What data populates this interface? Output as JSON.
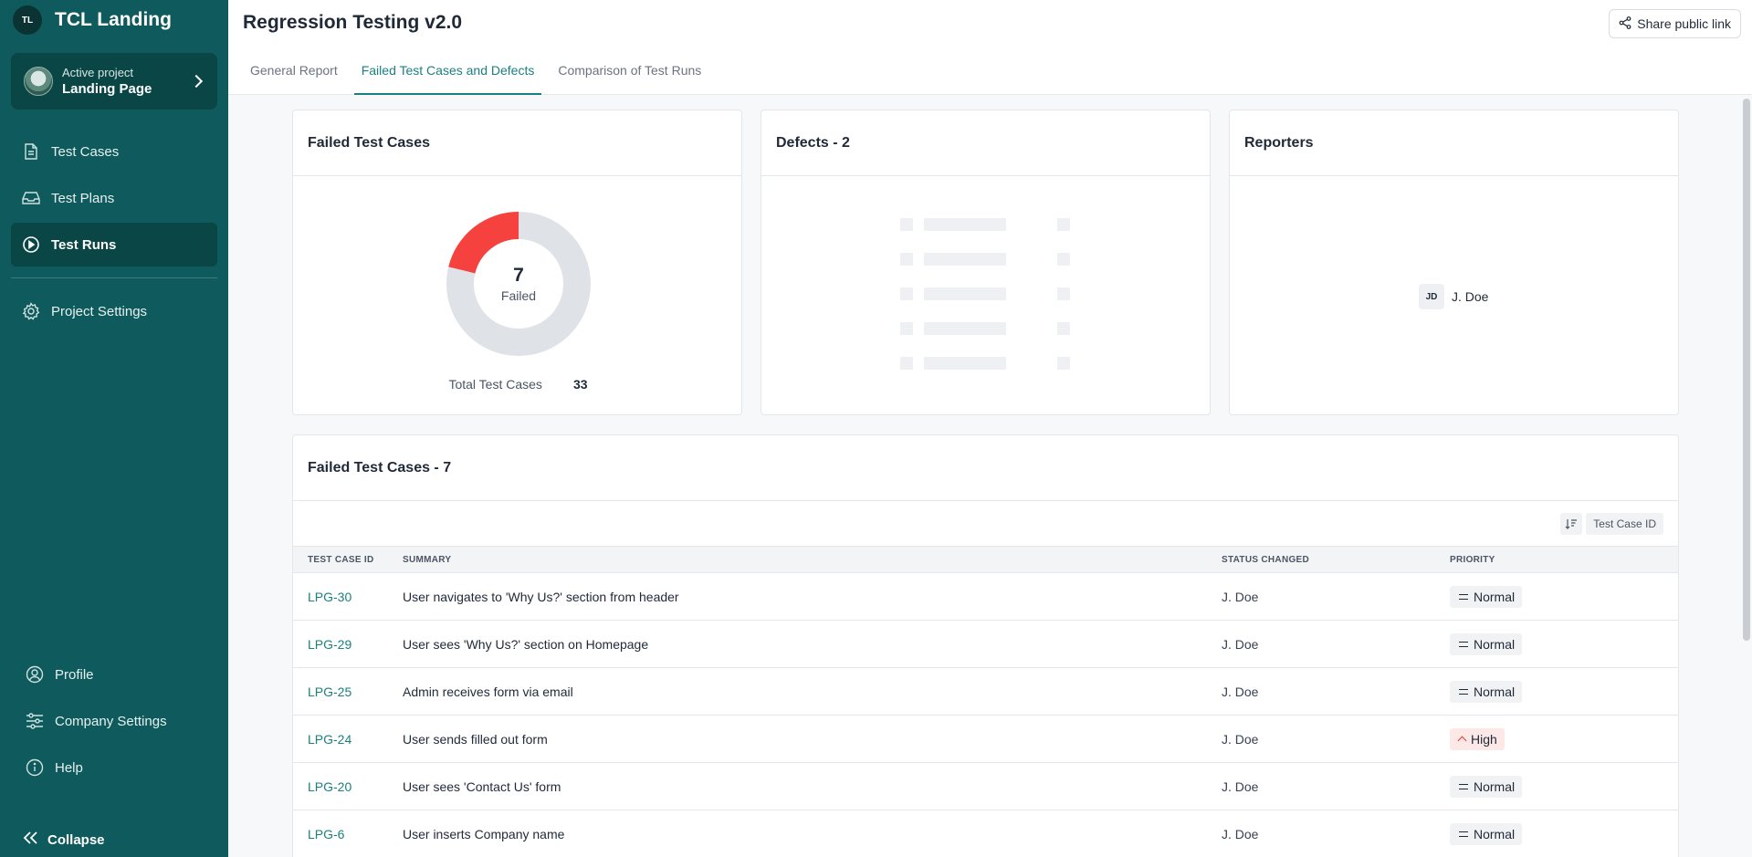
{
  "sidebar": {
    "logo_text": "TL",
    "brand_title": "TCL Landing",
    "project_label": "Active project",
    "project_name": "Landing Page",
    "nav": [
      {
        "label": "Test Cases",
        "icon": "file-icon"
      },
      {
        "label": "Test Plans",
        "icon": "inbox-icon"
      },
      {
        "label": "Test Runs",
        "icon": "play-circle-icon"
      }
    ],
    "settings_label": "Project Settings",
    "bottom": [
      {
        "label": "Profile",
        "icon": "user-circle-icon"
      },
      {
        "label": "Company Settings",
        "icon": "sliders-icon"
      },
      {
        "label": "Help",
        "icon": "info-icon"
      }
    ],
    "collapse_label": "Collapse"
  },
  "header": {
    "title": "Regression Testing v2.0",
    "share_label": "Share public link"
  },
  "tabs": [
    {
      "label": "General Report"
    },
    {
      "label": "Failed Test Cases and Defects"
    },
    {
      "label": "Comparison of Test Runs"
    }
  ],
  "failed_card": {
    "title": "Failed Test Cases",
    "count": "7",
    "count_label": "Failed",
    "total_label": "Total Test Cases",
    "total": "33",
    "failed_fraction": 0.2121,
    "colors": {
      "failed": "#f5423f",
      "rest": "#dfe2e6"
    }
  },
  "defects_card": {
    "title": "Defects - 2"
  },
  "reporters_card": {
    "title": "Reporters",
    "reporter_initials": "JD",
    "reporter_name": "J. Doe"
  },
  "table": {
    "title": "Failed Test Cases - 7",
    "sort_label": "Test Case ID",
    "columns": [
      "TEST CASE ID",
      "SUMMARY",
      "STATUS CHANGED",
      "PRIORITY"
    ],
    "rows": [
      {
        "id": "LPG-30",
        "summary": "User navigates to 'Why Us?' section from header",
        "status": "J. Doe",
        "priority": "Normal"
      },
      {
        "id": "LPG-29",
        "summary": "User sees 'Why Us?' section on Homepage",
        "status": "J. Doe",
        "priority": "Normal"
      },
      {
        "id": "LPG-25",
        "summary": "Admin receives form via email",
        "status": "J. Doe",
        "priority": "Normal"
      },
      {
        "id": "LPG-24",
        "summary": "User sends filled out form",
        "status": "J. Doe",
        "priority": "High"
      },
      {
        "id": "LPG-20",
        "summary": "User sees 'Contact Us' form",
        "status": "J. Doe",
        "priority": "Normal"
      },
      {
        "id": "LPG-6",
        "summary": "User inserts Company name",
        "status": "J. Doe",
        "priority": "Normal"
      }
    ]
  }
}
